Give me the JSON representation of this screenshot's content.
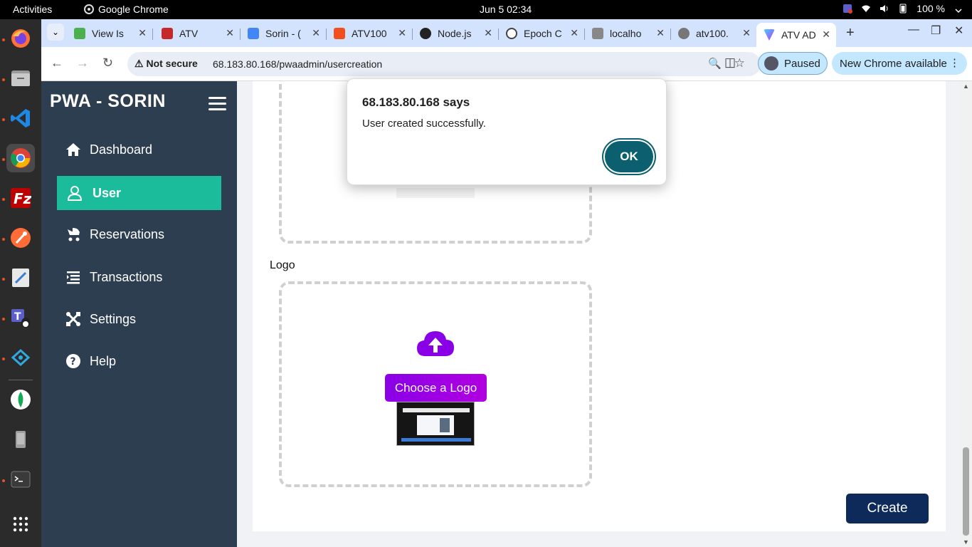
{
  "system_bar": {
    "activities": "Activities",
    "app_name": "Google Chrome",
    "clock": "Jun 5  02:34",
    "battery": "100 %"
  },
  "dock": {
    "items": [
      "firefox-icon",
      "files-icon",
      "vscode-icon",
      "chrome-icon",
      "filezilla-icon",
      "postman-icon",
      "text-editor-icon",
      "teams-icon",
      "remote-desktop-icon",
      "mongodb-compass-icon",
      "usb-drive-icon",
      "terminal-icon",
      "app-grid-icon"
    ]
  },
  "tabs": [
    {
      "label": "View Is",
      "color": "#4caf50"
    },
    {
      "label": "ATV",
      "color": "#c62828"
    },
    {
      "label": "Sorin - (",
      "color": "#4285f4"
    },
    {
      "label": "ATV100",
      "color": "#f24e1e"
    },
    {
      "label": "Node.js",
      "color": "#222222"
    },
    {
      "label": "Epoch C",
      "color": "#444444"
    },
    {
      "label": "localho",
      "color": "#888888"
    },
    {
      "label": "atv100.",
      "color": "#777777"
    },
    {
      "label": "ATV AD",
      "color": "#9c27b0",
      "active": true
    }
  ],
  "toolbar": {
    "security": "Not secure",
    "url": "68.183.80.168/pwaadmin/usercreation",
    "profile": "Paused",
    "update": "New Chrome available"
  },
  "sidebar": {
    "brand": "PWA - SORIN",
    "items": [
      {
        "label": "Dashboard",
        "icon": "home-icon"
      },
      {
        "label": "User",
        "icon": "user-icon",
        "active": true
      },
      {
        "label": "Reservations",
        "icon": "stroller-icon"
      },
      {
        "label": "Transactions",
        "icon": "list-icon"
      },
      {
        "label": "Settings",
        "icon": "tools-icon"
      },
      {
        "label": "Help",
        "icon": "help-icon"
      }
    ]
  },
  "form": {
    "logo_label": "Logo",
    "choose_logo": "Choose a Logo",
    "create": "Create"
  },
  "alert": {
    "title": "68.183.80.168 says",
    "message": "User created successfully.",
    "ok": "OK"
  },
  "colors": {
    "sidebar_bg": "#2d3e50",
    "active_nav": "#1abc9c",
    "create_button": "#0d2a5a",
    "choose_button": "#8a00e6",
    "ok_button": "#0b5f6e"
  }
}
